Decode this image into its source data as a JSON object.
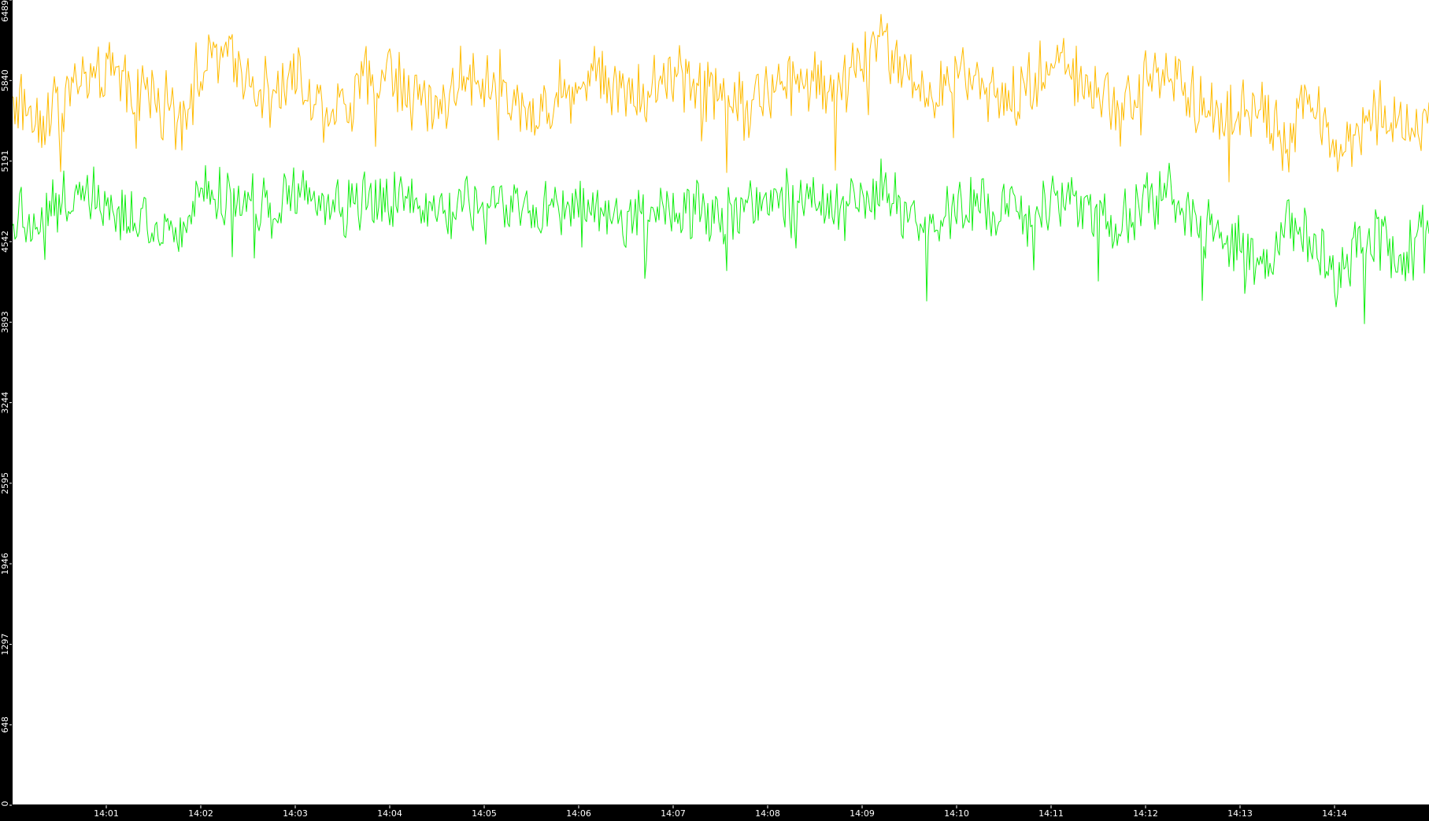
{
  "chart_data": {
    "type": "line",
    "title": "",
    "xlabel": "",
    "ylabel": "",
    "ylim": [
      0,
      6489
    ],
    "xlim_minutes": [
      0.0,
      15.0
    ],
    "yticks": [
      0,
      648,
      1297,
      1946,
      2595,
      3244,
      3893,
      4542,
      5191,
      5840,
      6489
    ],
    "xtick_labels": [
      "14:01",
      "14:02",
      "14:03",
      "14:04",
      "14:05",
      "14:06",
      "14:07",
      "14:08",
      "14:09",
      "14:10",
      "14:11",
      "14:12",
      "14:13",
      "14:14"
    ],
    "xtick_minutes": [
      1,
      2,
      3,
      4,
      5,
      6,
      7,
      8,
      9,
      10,
      11,
      12,
      13,
      14
    ],
    "grid": false,
    "legend": "none",
    "colors": {
      "background": "#000000",
      "plot_area": "#ffffff",
      "axis": "#000000",
      "tick_text": "#ffffff"
    },
    "series": [
      {
        "color": "#ffbb00",
        "x": [
          0.0,
          0.25,
          0.5,
          0.75,
          1.0,
          1.25,
          1.5,
          1.75,
          2.0,
          2.25,
          2.5,
          2.75,
          3.0,
          3.25,
          3.5,
          3.75,
          4.0,
          4.25,
          4.5,
          4.75,
          5.0,
          5.25,
          5.5,
          5.75,
          6.0,
          6.25,
          6.5,
          6.75,
          7.0,
          7.25,
          7.5,
          7.75,
          8.0,
          8.25,
          8.5,
          8.75,
          9.0,
          9.25,
          9.5,
          9.75,
          10.0,
          10.25,
          10.5,
          10.75,
          11.0,
          11.25,
          11.5,
          11.75,
          12.0,
          12.25,
          12.5,
          12.75,
          13.0,
          13.25,
          13.5,
          13.75,
          14.0,
          14.25,
          14.5,
          14.75,
          15.0
        ],
        "y": [
          5700,
          5550,
          5650,
          5850,
          5900,
          5800,
          5750,
          5500,
          5950,
          6050,
          5900,
          5750,
          5850,
          5650,
          5600,
          5850,
          5950,
          5700,
          5600,
          5850,
          5900,
          5700,
          5550,
          5700,
          5850,
          5900,
          5800,
          5700,
          5950,
          5850,
          5750,
          5650,
          5700,
          5850,
          5900,
          5750,
          6050,
          6150,
          5850,
          5700,
          5800,
          5900,
          5650,
          5800,
          5950,
          5900,
          5750,
          5700,
          5850,
          5950,
          5700,
          5600,
          5550,
          5650,
          5300,
          5750,
          5250,
          5450,
          5600,
          5400,
          5550
        ]
      },
      {
        "color": "#11ee11",
        "x": [
          0.0,
          0.25,
          0.5,
          0.75,
          1.0,
          1.25,
          1.5,
          1.75,
          2.0,
          2.25,
          2.5,
          2.75,
          3.0,
          3.25,
          3.5,
          3.75,
          4.0,
          4.25,
          4.5,
          4.75,
          5.0,
          5.25,
          5.5,
          5.75,
          6.0,
          6.25,
          6.5,
          6.75,
          7.0,
          7.25,
          7.5,
          7.75,
          8.0,
          8.25,
          8.5,
          8.75,
          9.0,
          9.25,
          9.5,
          9.75,
          10.0,
          10.25,
          10.5,
          10.75,
          11.0,
          11.25,
          11.5,
          11.75,
          12.0,
          12.25,
          12.5,
          12.75,
          13.0,
          13.25,
          13.5,
          13.75,
          14.0,
          14.25,
          14.5,
          14.75,
          15.0
        ],
        "y": [
          4800,
          4700,
          4850,
          4950,
          4900,
          4750,
          4700,
          4600,
          4950,
          4900,
          4850,
          4800,
          4950,
          4850,
          4750,
          4900,
          4850,
          4800,
          4750,
          4850,
          4800,
          4850,
          4750,
          4800,
          4850,
          4750,
          4700,
          4800,
          4800,
          4850,
          4750,
          4800,
          4850,
          4900,
          4950,
          4800,
          4900,
          4950,
          4750,
          4700,
          4800,
          4850,
          4750,
          4800,
          4900,
          4850,
          4800,
          4700,
          4850,
          4900,
          4700,
          4650,
          4500,
          4300,
          4650,
          4600,
          4200,
          4500,
          4550,
          4400,
          4700
        ]
      }
    ]
  }
}
